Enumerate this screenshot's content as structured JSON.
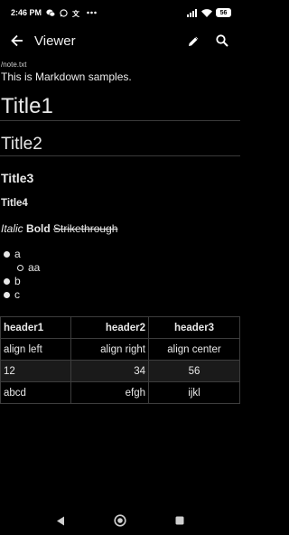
{
  "status_bar": {
    "time": "2:46 PM",
    "left_icons": [
      "wechat-icon",
      "whatsapp-icon",
      "translate-icon",
      "more-icon"
    ],
    "right_icons": [
      "signal-icon",
      "wifi-icon",
      "battery-icon"
    ],
    "battery": "56"
  },
  "app_bar": {
    "title": "Viewer"
  },
  "doc": {
    "path": "/note.txt",
    "intro": "This is Markdown samples.",
    "h1": "Title1",
    "h2": "Title2",
    "h3": "Title3",
    "h4": "Title4",
    "italic": "Italic",
    "bold": "Bold",
    "strike": "Strikethrough",
    "list": [
      {
        "text": "a",
        "level": 0
      },
      {
        "text": "aa",
        "level": 1
      },
      {
        "text": "b",
        "level": 0
      },
      {
        "text": "c",
        "level": 0
      }
    ],
    "table": {
      "headers": [
        "header1",
        "header2",
        "header3"
      ],
      "rows": [
        [
          "align left",
          "align right",
          "align center"
        ],
        [
          "12",
          "34",
          "56"
        ],
        [
          "abcd",
          "efgh",
          "ijkl"
        ]
      ]
    }
  },
  "nav_bar": {
    "buttons": [
      "back-triangle-icon",
      "home-circle-icon",
      "recents-square-icon"
    ]
  }
}
